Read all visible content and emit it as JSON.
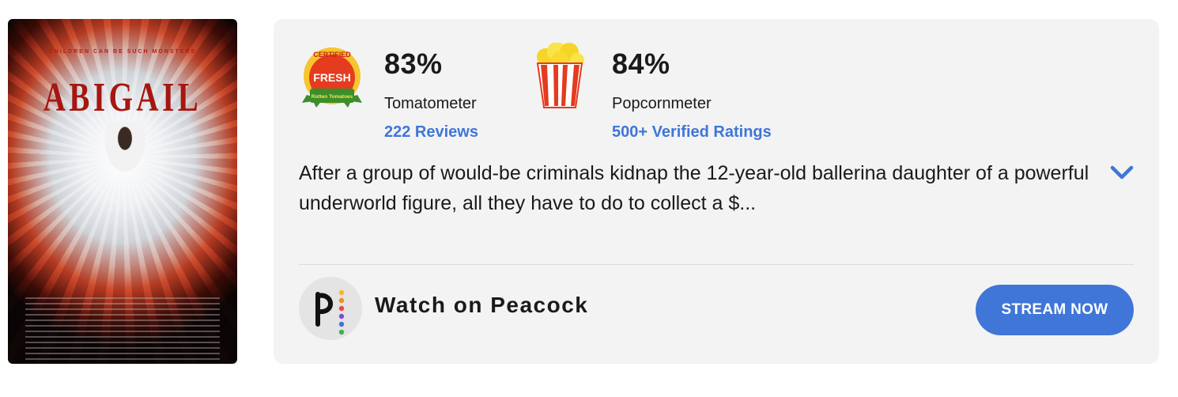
{
  "poster": {
    "tagline": "CHILDREN CAN BE SUCH MONSTERS",
    "title": "ABIGAIL"
  },
  "tomatometer": {
    "icon": "certified-fresh-icon",
    "badge_top": "CERTIFIED",
    "badge_mid": "FRESH",
    "badge_bottom": "Rotten Tomatoes",
    "score": "83%",
    "label": "Tomatometer",
    "reviews_link": "222 Reviews"
  },
  "popcornmeter": {
    "icon": "popcorn-bucket-icon",
    "score": "84%",
    "label": "Popcornmeter",
    "ratings_link": "500+ Verified Ratings"
  },
  "synopsis": {
    "text": "After a group of would-be criminals kidnap the 12-year-old ballerina daughter of a powerful underworld figure, all they have to do to collect a $...",
    "expand_icon": "chevron-down-icon"
  },
  "watch": {
    "logo_icon": "peacock-logo-icon",
    "label": "Watch on Peacock",
    "button_label": "STREAM NOW"
  },
  "colors": {
    "accent": "#3f76d7",
    "card_bg": "#f3f3f3",
    "text": "#1a1a1a"
  }
}
